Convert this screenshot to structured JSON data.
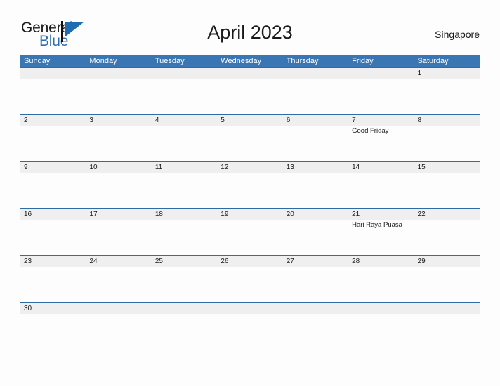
{
  "brand": {
    "name_part1": "General",
    "name_part2": "Blue",
    "mark_icon": "flag-triangle-icon",
    "accent_color": "#2f6fb0"
  },
  "header": {
    "title": "April 2023",
    "locale": "Singapore"
  },
  "colors": {
    "weekday_header_bg": "#3a76b4",
    "weekday_header_text": "#ffffff",
    "daynum_band_bg": "#efefef",
    "row_divider": "#2e6da4",
    "page_bg": "#fdfdfd",
    "text": "#1a1a1a"
  },
  "calendar": {
    "month": "April",
    "year": "2023",
    "weekday_headers": [
      "Sunday",
      "Monday",
      "Tuesday",
      "Wednesday",
      "Thursday",
      "Friday",
      "Saturday"
    ],
    "weeks": [
      {
        "days": [
          {
            "num": "",
            "event": ""
          },
          {
            "num": "",
            "event": ""
          },
          {
            "num": "",
            "event": ""
          },
          {
            "num": "",
            "event": ""
          },
          {
            "num": "",
            "event": ""
          },
          {
            "num": "",
            "event": ""
          },
          {
            "num": "1",
            "event": ""
          }
        ]
      },
      {
        "days": [
          {
            "num": "2",
            "event": ""
          },
          {
            "num": "3",
            "event": ""
          },
          {
            "num": "4",
            "event": ""
          },
          {
            "num": "5",
            "event": ""
          },
          {
            "num": "6",
            "event": ""
          },
          {
            "num": "7",
            "event": "Good Friday"
          },
          {
            "num": "8",
            "event": ""
          }
        ]
      },
      {
        "days": [
          {
            "num": "9",
            "event": ""
          },
          {
            "num": "10",
            "event": ""
          },
          {
            "num": "11",
            "event": ""
          },
          {
            "num": "12",
            "event": ""
          },
          {
            "num": "13",
            "event": ""
          },
          {
            "num": "14",
            "event": ""
          },
          {
            "num": "15",
            "event": ""
          }
        ]
      },
      {
        "days": [
          {
            "num": "16",
            "event": ""
          },
          {
            "num": "17",
            "event": ""
          },
          {
            "num": "18",
            "event": ""
          },
          {
            "num": "19",
            "event": ""
          },
          {
            "num": "20",
            "event": ""
          },
          {
            "num": "21",
            "event": "Hari Raya Puasa"
          },
          {
            "num": "22",
            "event": ""
          }
        ]
      },
      {
        "days": [
          {
            "num": "23",
            "event": ""
          },
          {
            "num": "24",
            "event": ""
          },
          {
            "num": "25",
            "event": ""
          },
          {
            "num": "26",
            "event": ""
          },
          {
            "num": "27",
            "event": ""
          },
          {
            "num": "28",
            "event": ""
          },
          {
            "num": "29",
            "event": ""
          }
        ]
      },
      {
        "days": [
          {
            "num": "30",
            "event": ""
          },
          {
            "num": "",
            "event": ""
          },
          {
            "num": "",
            "event": ""
          },
          {
            "num": "",
            "event": ""
          },
          {
            "num": "",
            "event": ""
          },
          {
            "num": "",
            "event": ""
          },
          {
            "num": "",
            "event": ""
          }
        ]
      }
    ]
  }
}
